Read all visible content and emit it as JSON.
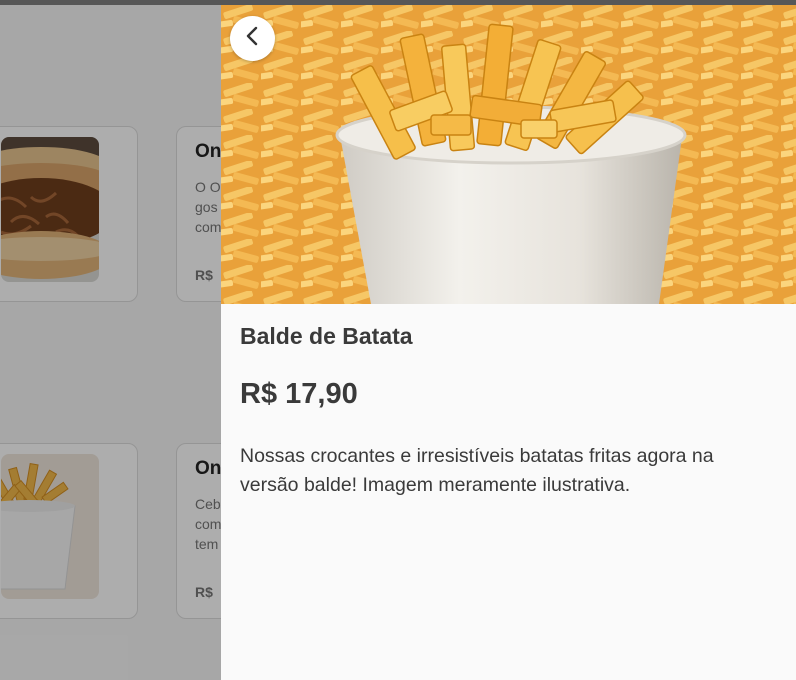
{
  "listing": {
    "cards": [
      {
        "title": "On",
        "desc": "O O\ngos\ncom",
        "price": "R$"
      },
      {
        "title": "On",
        "desc": "Ceb\ncom\ntem",
        "price": "R$"
      }
    ]
  },
  "detail": {
    "back_icon": "chevron-left-icon",
    "title": "Balde de Batata",
    "price": "R$ 17,90",
    "description": "Nossas crocantes e irresistíveis batatas fritas agora na versão balde! Imagem meramente ilustrativa."
  },
  "colors": {
    "overlay": "rgba(0,0,0,0.32)",
    "panel_bg": "#fafafa",
    "text_dark": "#3a3a3a",
    "fries": "#f0a12b"
  }
}
